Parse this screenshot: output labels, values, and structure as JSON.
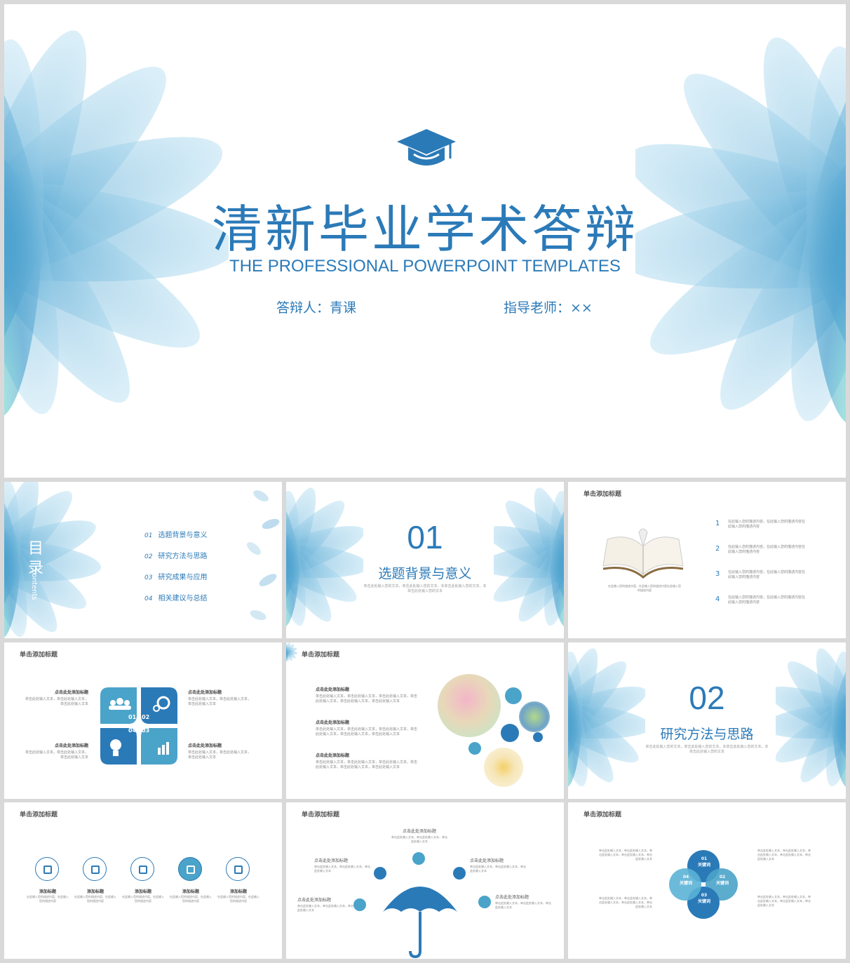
{
  "hero": {
    "title": "清新毕业学术答辩",
    "subtitle": "THE PROFESSIONAL POWERPOINT TEMPLATES",
    "presenter": "答辩人：青课",
    "advisor": "指导老师：××"
  },
  "toc": {
    "title": "目录",
    "title_en": "contents",
    "items": [
      {
        "num": "01",
        "label": "选题背景与意义"
      },
      {
        "num": "02",
        "label": "研究方法与思路"
      },
      {
        "num": "03",
        "label": "研究成果与应用"
      },
      {
        "num": "04",
        "label": "相关建议与总结"
      }
    ]
  },
  "section1": {
    "num": "01",
    "title": "选题背景与意义",
    "desc": "单击此处输入您的文本，单击此处输入您的文本，本单击此处输入您的文本，本单击此处输入您的文本"
  },
  "section2": {
    "num": "02",
    "title": "研究方法与思路",
    "desc": "单击此处输入您的文本，单击此处输入您的文本，本单击此处输入您的文本，本单击此处输入您的文本"
  },
  "slide_header": "单击添加标题",
  "book_slide": {
    "caption": "在此输入您的描述内容，在此输入您的描述内容在此输入您的描述内容",
    "items": [
      {
        "num": "1",
        "text": "在此输入您的描述内容，在此输入您的描述内容在此输入您的描述内容"
      },
      {
        "num": "2",
        "text": "在此输入您的描述内容，在此输入您的描述内容在此输入您的描述内容"
      },
      {
        "num": "3",
        "text": "在此输入您的描述内容，在此输入您的描述内容在此输入您的描述内容"
      },
      {
        "num": "4",
        "text": "在此输入您的描述内容，在此输入您的描述内容在此输入您的描述内容"
      }
    ]
  },
  "grid_slide": {
    "blocks": [
      {
        "title": "点击此处添加标题",
        "text": "单击此处输入文本，单击此处输入文本，单击此处输入文本"
      },
      {
        "title": "点击此处添加标题",
        "text": "单击此处输入文本，单击此处输入文本，单击此处输入文本"
      },
      {
        "title": "点击此处添加标题",
        "text": "单击此处输入文本，单击此处输入文本，单击此处输入文本"
      },
      {
        "title": "点击此处添加标题",
        "text": "单击此处输入文本，单击此处输入文本，单击此处输入文本"
      }
    ],
    "nums": [
      "01",
      "02",
      "04",
      "03"
    ]
  },
  "photo_slide": {
    "blocks": [
      {
        "title": "点击此处添加标题",
        "text": "单击此处输入文本，单击此处输入文本，单击此处输入文本，单击此处输入文本，单击此处输入文本，单击此处输入文本"
      },
      {
        "title": "点击此处添加标题",
        "text": "单击此处输入文本，单击此处输入文本，单击此处输入文本，单击此处输入文本，单击此处输入文本，单击此处输入文本"
      },
      {
        "title": "点击此处添加标题",
        "text": "单击此处输入文本，单击此处输入文本，单击此处输入文本，单击此处输入文本，单击此处输入文本，单击此处输入文本"
      }
    ]
  },
  "icons_slide": {
    "items": [
      {
        "title": "添加标题",
        "text": "在此输入您的描述内容，在此输入您的描述内容",
        "icon": "link-icon"
      },
      {
        "title": "添加标题",
        "text": "在此输入您的描述内容，在此输入您的描述内容",
        "icon": "laptop-icon"
      },
      {
        "title": "添加标题",
        "text": "在此输入您的描述内容，在此输入您的描述内容",
        "icon": "folder-icon"
      },
      {
        "title": "添加标题",
        "text": "在此输入您的描述内容，在此输入您的描述内容",
        "icon": "pen-icon"
      },
      {
        "title": "添加标题",
        "text": "在此输入您的描述内容，在此输入您的描述内容",
        "icon": "presentation-icon"
      }
    ]
  },
  "umbrella_slide": {
    "items": [
      {
        "title": "点击此处添加标题",
        "text": "单击此处输入文本，单击此处输入文本，单击此处输入文本"
      },
      {
        "title": "点击此处添加标题",
        "text": "单击此处输入文本，单击此处输入文本，单击此处输入文本"
      },
      {
        "title": "点击此处添加标题",
        "text": "单击此处输入文本，单击此处输入文本，单击此处输入文本"
      },
      {
        "title": "点击此处添加标题",
        "text": "单击此处输入文本，单击此处输入文本，单击此处输入文本"
      },
      {
        "title": "点击此处添加标题",
        "text": "单击此处输入文本，单击此处输入文本，单击此处输入文本"
      }
    ]
  },
  "keyword_slide": {
    "keywords": [
      {
        "num": "01",
        "label": "关键词"
      },
      {
        "num": "02",
        "label": "关键词"
      },
      {
        "num": "03",
        "label": "关键词"
      },
      {
        "num": "04",
        "label": "关键词"
      }
    ],
    "texts": [
      "单击此处输入文本，单击此处输入文本，单击此处输入文本，单击此处输入文本，单击此处输入文本",
      "单击此处输入文本，单击此处输入文本，单击此处输入文本，单击此处输入文本，单击此处输入文本",
      "单击此处输入文本，单击此处输入文本，单击此处输入文本，单击此处输入文本，单击此处输入文本",
      "单击此处输入文本，单击此处输入文本，单击此处输入文本，单击此处输入文本，单击此处输入文本"
    ]
  },
  "colors": {
    "primary": "#2b7ab8",
    "accent": "#5bb3d6",
    "petal": "#7cc3e6"
  }
}
